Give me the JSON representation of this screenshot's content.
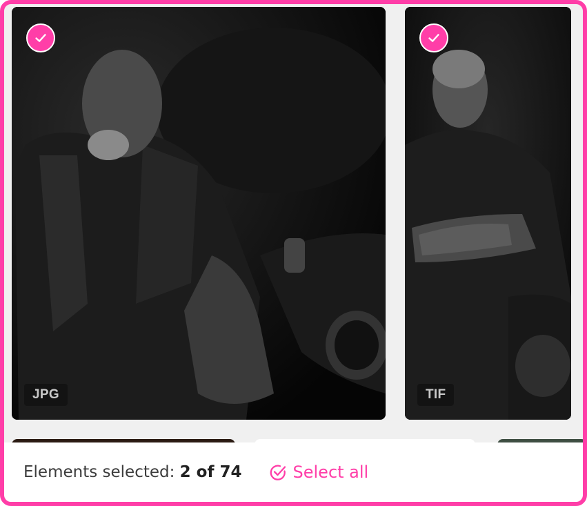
{
  "gallery": {
    "items": [
      {
        "format": "JPG",
        "selected": true
      },
      {
        "format": "TIF",
        "selected": true
      }
    ]
  },
  "footer": {
    "label": "Elements selected:",
    "count": "2 of 74",
    "select_all_label": "Select all"
  },
  "colors": {
    "accent": "#ff3ea8",
    "panel_bg": "#f0f0f0",
    "footer_bg": "#ffffff"
  }
}
